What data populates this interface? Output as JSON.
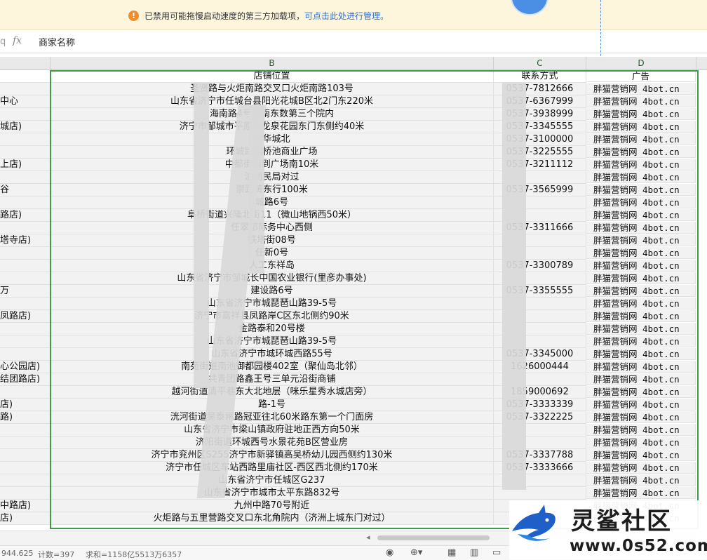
{
  "notification": {
    "text": "已禁用可能拖慢启动速度的第三方加载项，",
    "link": "可点击此处进行管理。"
  },
  "formula_bar": {
    "fx": "fx",
    "value": "商家名称"
  },
  "columns": [
    "B",
    "C",
    "D"
  ],
  "headers": {
    "b": "店铺位置",
    "c": "联系方式",
    "d": "广告"
  },
  "rows": [
    {
      "a": "",
      "b": "圣贤路与火炬南路交叉口火炬南路103号",
      "c": "0537-7812666",
      "d": "胖猫营销网 4bot.cn"
    },
    {
      "a": "中心",
      "b": "山东省济宁市任城台县阳光花城B区北2门东220米",
      "c": "0537-6367999",
      "d": "胖猫营销网 4bot.cn"
    },
    {
      "a": "",
      "b": "海南路4号路南东数第三个院内",
      "c": "0537-3938999",
      "d": "胖猫营销网 4bot.cn"
    },
    {
      "a": "城店)",
      "b": "济宁市邹城市平原路龙泉花园东门东侧约40米",
      "c": "0537-3345555",
      "d": "胖猫营销网 4bot.cn"
    },
    {
      "a": "",
      "b": "金华城北",
      "c": "0537-3100000",
      "d": "胖猫营销网 4bot.cn"
    },
    {
      "a": "",
      "b": "环城路越桥池商业广场",
      "c": "0537-3225555",
      "d": "胖猫营销网 4bot.cn"
    },
    {
      "a": "上店)",
      "b": "中都街南到广场南10米",
      "c": "0537-3211112",
      "d": "胖猫营销网 4bot.cn"
    },
    {
      "a": "",
      "b": "泊南民局对过",
      "c": "",
      "d": "胖猫营销网 4bot.cn"
    },
    {
      "a": "谷",
      "b": "崇路黄东行100米",
      "c": "0537-3565999",
      "d": "胖猫营销网 4bot.cn"
    },
    {
      "a": "",
      "b": "城路6号",
      "c": "",
      "d": "胖猫营销网 4bot.cn"
    },
    {
      "a": "路店)",
      "b": "阜桥街道兴隆北街11（微山地锅西50米）",
      "c": "",
      "d": "胖猫营销网 4bot.cn"
    },
    {
      "a": "",
      "b": "任翠都际务中心西侧",
      "c": "0537-3311666",
      "d": "胖猫营销网 4bot.cn"
    },
    {
      "a": "塔寺店)",
      "b": "铁塔街08号",
      "c": "",
      "d": "胖猫营销网 4bot.cn"
    },
    {
      "a": "",
      "b": "任新0号",
      "c": "",
      "d": "胖猫营销网 4bot.cn"
    },
    {
      "a": "",
      "b": "人工东祥岛",
      "c": "0537-3300789",
      "d": "胖猫营销网 4bot.cn"
    },
    {
      "a": "",
      "b": "山东省济宁市邹城长中国农业银行(里彦办事处)",
      "c": "",
      "d": "胖猫营销网 4bot.cn"
    },
    {
      "a": "万",
      "b": "建设路6号",
      "c": "0537-3355555",
      "d": "胖猫营销网 4bot.cn"
    },
    {
      "a": "",
      "b": "山东省济宁市城琵琶山路39-5号",
      "c": "",
      "d": "胖猫营销网 4bot.cn"
    },
    {
      "a": "凤路店)",
      "b": "济宁市嘉祥县凤路岸C区东北侧约90米",
      "c": "",
      "d": "胖猫营销网 4bot.cn"
    },
    {
      "a": "",
      "b": "金路泰和20号楼",
      "c": "",
      "d": "胖猫营销网 4bot.cn"
    },
    {
      "a": "",
      "b": "山东省济宁市城琵琶山路39-5号",
      "c": "",
      "d": "胖猫营销网 4bot.cn"
    },
    {
      "a": "",
      "b": "山东省济宁市城环城西路55号",
      "c": "0537-3345000",
      "d": "胖猫营销网 4bot.cn"
    },
    {
      "a": "心公园店)",
      "b": "南苑街道南池御都园楼402室（聚仙岛北邻）",
      "c": "1626000444",
      "d": "胖猫营销网 4bot.cn"
    },
    {
      "a": "结团路店)",
      "b": "共青团路鑫王号三单元沿街商铺",
      "c": "",
      "d": "胖猫营销网 4bot.cn"
    },
    {
      "a": "",
      "b": "越河街道清平巷东大北地层（咪乐星秀水城店旁）",
      "c": "1859000692",
      "d": "胖猫营销网 4bot.cn"
    },
    {
      "a": "店)",
      "b": "路-1号",
      "c": "0537-3333339",
      "d": "胖猫营销网 4bot.cn"
    },
    {
      "a": "路)",
      "b": "洸河街道吴泰闸路冠亚往北60米路东第一个门面房",
      "c": "0537-3322225",
      "d": "胖猫营销网 4bot.cn"
    },
    {
      "a": "",
      "b": "山东省济宁市梁山镇政府驻地正西方向50米",
      "c": "",
      "d": "胖猫营销网 4bot.cn"
    },
    {
      "a": "",
      "b": "济阳街道环城西号水景花苑B区营业房",
      "c": "",
      "d": "胖猫营销网 4bot.cn"
    },
    {
      "a": "",
      "b": "济宁市兖州区S255济宁市新驿镇高吴桥幼儿园西侧约130米",
      "c": "0537-3337788",
      "d": "胖猫营销网 4bot.cn"
    },
    {
      "a": "",
      "b": "济宁市任城区车站西路里庙社区-西区西北侧约170米",
      "c": "0537-3333666",
      "d": "胖猫营销网 4bot.cn"
    },
    {
      "a": "",
      "b": "山东省济宁市任城区G237",
      "c": "",
      "d": "胖猫营销网 4bot.cn"
    },
    {
      "a": "",
      "b": "山东省济宁市城市太平东路832号",
      "c": "",
      "d": "胖猫营销网 4bot.cn"
    },
    {
      "a": "中路店)",
      "b": "九州中路70号附近",
      "c": "",
      "d": "胖猫营销网 4bot.cn"
    },
    {
      "a": "店)",
      "b": "火炬路与五里营路交叉口东北角院内（济洲上城东门对过）",
      "c": "",
      "d": "胖猫营销网 4bot.cn"
    }
  ],
  "status_bar": {
    "avg": "944.625",
    "count": "计数=397",
    "sum": "求和=1158亿5513万6357"
  },
  "watermark": {
    "title": "灵鲨社区",
    "url": "www.0s52.com"
  },
  "colors": {
    "accent_green": "#3e9b49",
    "notice_bg": "#fdf6dd",
    "link": "#2b6fd6"
  },
  "icons": [
    "warning-icon",
    "fx-icon",
    "eye-icon",
    "cell-style-icon",
    "normal-view-icon",
    "page-layout-icon",
    "page-break-icon"
  ]
}
